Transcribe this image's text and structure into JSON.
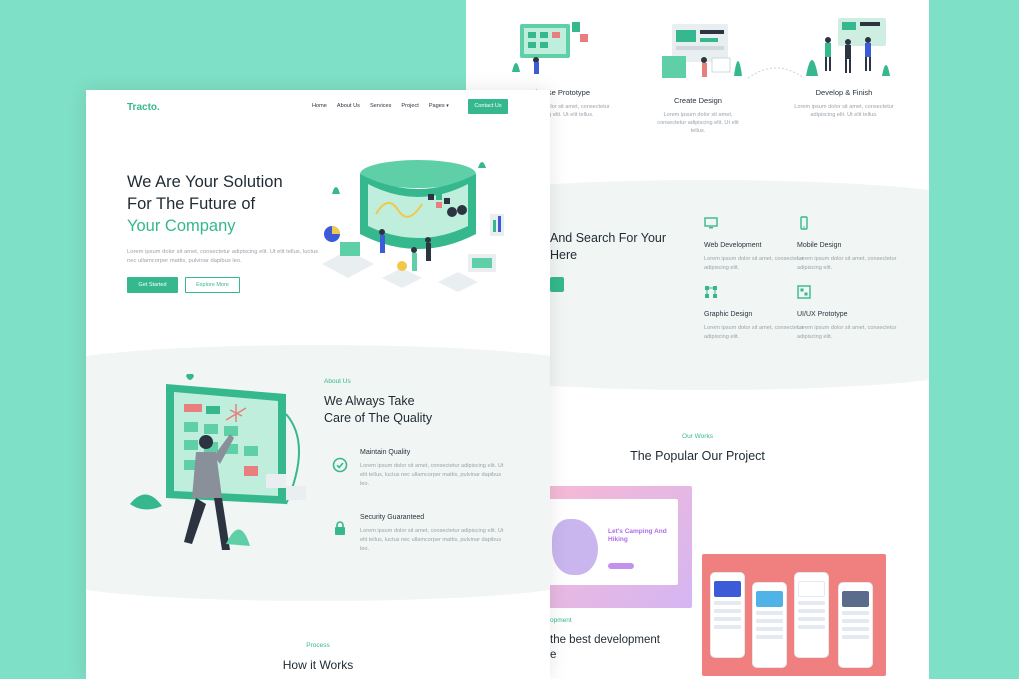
{
  "colors": {
    "background": "#7ee0c6",
    "accent": "#35b88e",
    "text": "#1f2a33",
    "muted": "#9aa3ab"
  },
  "back": {
    "steps": [
      {
        "title": "Choose Prototype",
        "desc": "Lorem ipsum dolor sit amet, consectetur adipiscing elit. Ut elit tellus."
      },
      {
        "title": "Create Design",
        "desc": "Lorem ipsum dolor sit amet, consectetur adipiscing elit. Ut elit tellus."
      },
      {
        "title": "Develop & Finish",
        "desc": "Lorem ipsum dolor sit amet, consectetur adipiscing elit. Ut elit tellus."
      }
    ],
    "search_title_line1": "And Search For Your",
    "search_title_line2": "Here",
    "services": [
      {
        "icon": "monitor-icon",
        "title": "Web Development",
        "desc": "Lorem ipsum dolor sit amet, consectetur adipiscing elit."
      },
      {
        "icon": "mobile-icon",
        "title": "Mobile Design",
        "desc": "Lorem ipsum dolor sit amet, consectetur adipiscing elit."
      },
      {
        "icon": "graphic-icon",
        "title": "Graphic Design",
        "desc": "Lorem ipsum dolor sit amet, consectetur adipiscing elit."
      },
      {
        "icon": "ui-ux-icon",
        "title": "UI/UX Prototype",
        "desc": "Lorem ipsum dolor sit amet, consectetur adipiscing elit."
      }
    ],
    "works_kicker": "Our Works",
    "works_title": "The Popular Our Project",
    "card1_text": "Let's Camping And Hiking",
    "dev_kicker": "opment",
    "dev_title_line1": "the best development",
    "dev_title_line2": "e"
  },
  "front": {
    "logo": "Tracto.",
    "nav": [
      "Home",
      "About Us",
      "Services",
      "Project",
      "Pages"
    ],
    "contact_label": "Contact Us",
    "hero": {
      "line1": "We Are Your Solution",
      "line2": "For The Future of",
      "line3": "Your Company",
      "desc": "Lorem ipsum dolor sit amet, consectetur adipiscing elit. Ut elit tellus, luctus nec ullamcorper mattis, pulvinar dapibus leo.",
      "primary_label": "Get Started",
      "secondary_label": "Explore More"
    },
    "about": {
      "kicker": "About Us",
      "title_line1": "We Always Take",
      "title_line2": "Care of The Quality",
      "features": [
        {
          "title": "Maintain Quality",
          "desc": "Lorem ipsum dolor sit amet, consectetur adipiscing elit. Ut elit tellus, luctus nec ullamcorper mattis, pulvinar dapibus leo."
        },
        {
          "title": "Security Guaranteed",
          "desc": "Lorem ipsum dolor sit amet, consectetur adipiscing elit. Ut elit tellus, luctus nec ullamcorper mattis, pulvinar dapibus leo."
        }
      ]
    },
    "process_kicker": "Process",
    "process_title": "How it Works"
  }
}
